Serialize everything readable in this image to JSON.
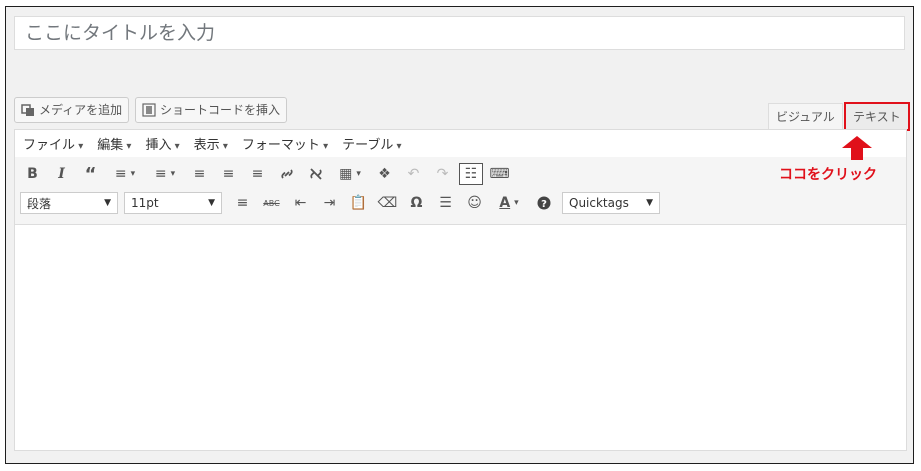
{
  "title_placeholder": "ここにタイトルを入力",
  "media_buttons": {
    "add_media": "メディアを追加",
    "insert_shortcode": "ショートコードを挿入"
  },
  "tabs": {
    "visual": "ビジュアル",
    "text": "テキスト"
  },
  "menubar": [
    "ファイル",
    "編集",
    "挿入",
    "表示",
    "フォーマット",
    "テーブル"
  ],
  "format_select": {
    "block": "段落",
    "size": "11pt",
    "quicktags": "Quicktags"
  },
  "annotation": "ココをクリック",
  "colors": {
    "highlight": "#e0101a",
    "arrow": "#e0101a"
  }
}
